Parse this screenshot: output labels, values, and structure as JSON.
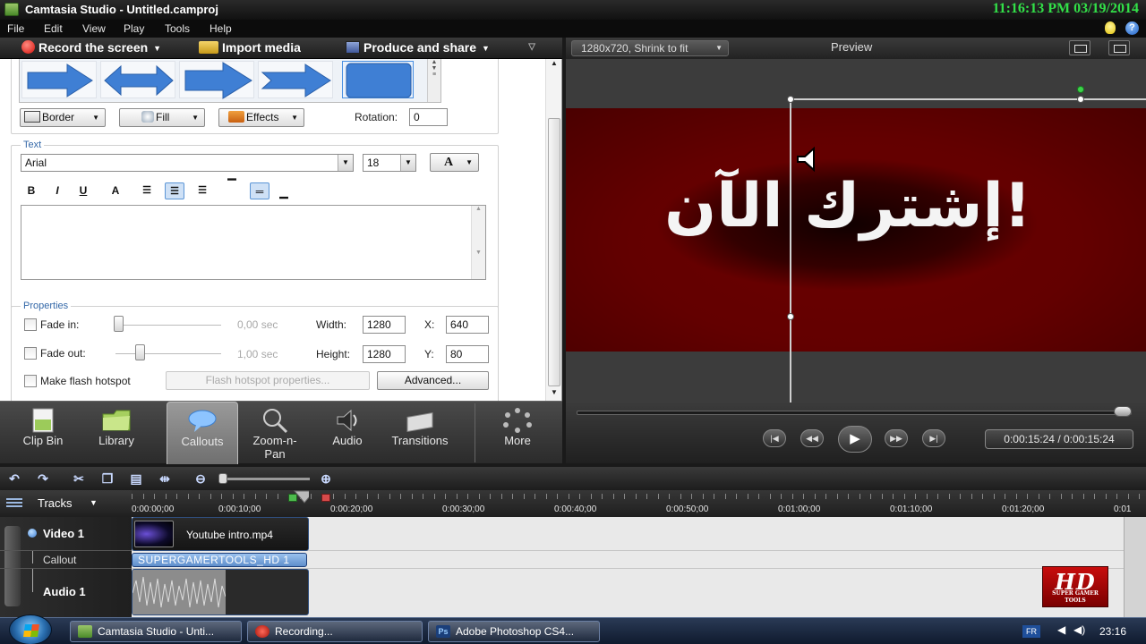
{
  "window": {
    "title": "Camtasia Studio - Untitled.camproj",
    "clock": "11:16:13 PM 03/19/2014"
  },
  "menu": [
    "File",
    "Edit",
    "View",
    "Play",
    "Tools",
    "Help"
  ],
  "toolbar": {
    "record": "Record the screen",
    "import": "Import media",
    "produce": "Produce and share"
  },
  "callout": {
    "border_label": "Border",
    "fill_label": "Fill",
    "effects_label": "Effects",
    "rotation_label": "Rotation:",
    "rotation_value": "0",
    "text_group": "Text",
    "font": "Arial",
    "font_size": "18",
    "color_glyph": "A",
    "format_buttons": [
      "B",
      "I",
      "U",
      "A"
    ],
    "properties_group": "Properties",
    "fade_in_label": "Fade in:",
    "fade_in_value": "0,00 sec",
    "fade_in_level": 0,
    "fade_out_label": "Fade out:",
    "fade_out_value": "1,00 sec",
    "fade_out_level": 0.2,
    "width_label": "Width:",
    "width_value": "1280",
    "height_label": "Height:",
    "height_value": "1280",
    "x_label": "X:",
    "x_value": "640",
    "y_label": "Y:",
    "y_value": "80",
    "hotspot_label": "Make flash hotspot",
    "hotspot_props": "Flash hotspot properties...",
    "advanced": "Advanced..."
  },
  "tasks": [
    {
      "label": "Clip Bin"
    },
    {
      "label": "Library"
    },
    {
      "label": "Callouts"
    },
    {
      "label": "Zoom-n-Pan"
    },
    {
      "label": "Audio"
    },
    {
      "label": "Transitions"
    },
    {
      "label": "More"
    }
  ],
  "preview": {
    "size_option": "1280x720, Shrink to fit",
    "title": "Preview",
    "video_text": "إشترك الآن!",
    "timecode": "0:00:15:24 / 0:00:15:24",
    "progress": 1.0
  },
  "timeline": {
    "tracks_label": "Tracks",
    "ruler": [
      "0:00:00;00",
      "0:00:10;00",
      "0:00:20;00",
      "0:00:30;00",
      "0:00:40;00",
      "0:00:50;00",
      "0:01:00;00",
      "0:01:10;00",
      "0:01:20;00",
      "0:01"
    ],
    "track_video": "Video 1",
    "track_callout": "Callout",
    "track_audio": "Audio 1",
    "clip_video": "Youtube intro.mp4",
    "clip_callout": "SUPERGAMERTOOLS_HD 1",
    "logo_text": "HD",
    "logo_small": "SUPER GAMER TOOLS"
  },
  "taskbar": {
    "items": [
      "Camtasia Studio - Unti...",
      "Recording...",
      "Adobe Photoshop CS4..."
    ],
    "lang": "FR",
    "time": "23:16"
  },
  "colors": {
    "video_bg": "#630000",
    "clock_green": "#32e048",
    "accent_blue": "#3468a8"
  }
}
